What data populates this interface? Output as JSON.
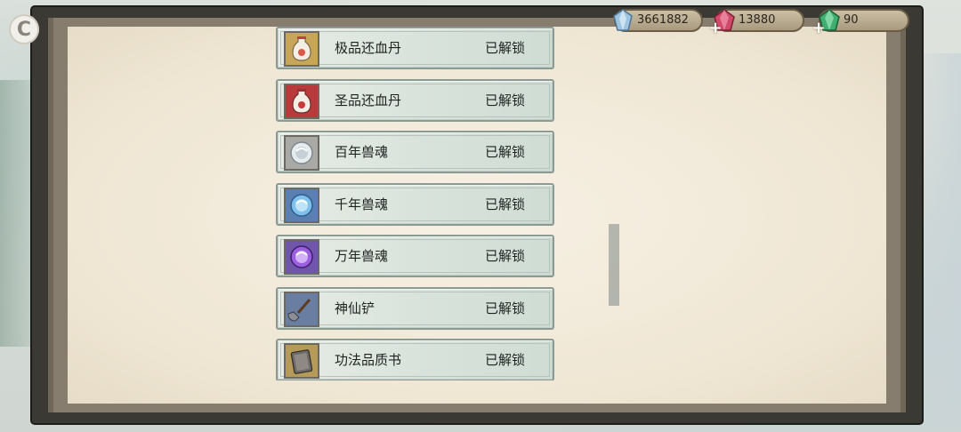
{
  "back_glyph": "C",
  "currencies": [
    {
      "id": "crystal",
      "value": "3661882",
      "color": "#8fb8d8"
    },
    {
      "id": "ruby",
      "value": "13880",
      "color": "#d24a6b"
    },
    {
      "id": "jade",
      "value": "90",
      "color": "#3fae6e"
    }
  ],
  "plus_glyph": "+",
  "items": [
    {
      "name": "极品还血丹",
      "status": "已解锁",
      "icon": "vase-icon",
      "frame": "#c8a659"
    },
    {
      "name": "圣品还血丹",
      "status": "已解锁",
      "icon": "vase-icon",
      "frame": "#b83a3a"
    },
    {
      "name": "百年兽魂",
      "status": "已解锁",
      "icon": "orb-icon",
      "frame": "#b9b9b5"
    },
    {
      "name": "千年兽魂",
      "status": "已解锁",
      "icon": "orb-icon",
      "frame": "#5a7fb0"
    },
    {
      "name": "万年兽魂",
      "status": "已解锁",
      "icon": "orb-icon",
      "frame": "#6f56a8"
    },
    {
      "name": "神仙铲",
      "status": "已解锁",
      "icon": "shovel-icon",
      "frame": "#6a7ea2"
    },
    {
      "name": "功法品质书",
      "status": "已解锁",
      "icon": "book-icon",
      "frame": "#b69a5a"
    }
  ]
}
